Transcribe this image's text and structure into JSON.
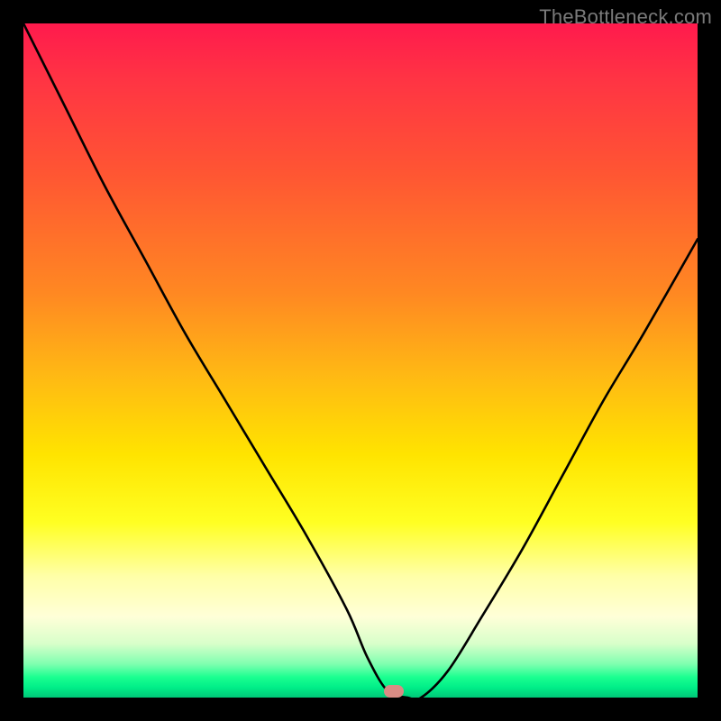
{
  "watermark": "TheBottleneck.com",
  "marker": {
    "x_pct": 55.0,
    "y_pct": 99.0
  },
  "chart_data": {
    "type": "line",
    "title": "",
    "xlabel": "",
    "ylabel": "",
    "xlim": [
      0,
      100
    ],
    "ylim": [
      0,
      100
    ],
    "series": [
      {
        "name": "bottleneck-curve",
        "x": [
          0,
          6,
          12,
          18,
          24,
          30,
          36,
          42,
          48,
          51,
          54,
          57,
          59,
          63,
          68,
          74,
          80,
          86,
          92,
          100
        ],
        "y": [
          100,
          88,
          76,
          65,
          54,
          44,
          34,
          24,
          13,
          6,
          1,
          0,
          0,
          4,
          12,
          22,
          33,
          44,
          54,
          68
        ]
      }
    ],
    "gradient_meaning": "vertical color gradient from red (high bottleneck) at top to green (optimal) at bottom",
    "highlight_point": {
      "x": 55,
      "y": 0,
      "meaning": "optimal match / minimum bottleneck"
    }
  }
}
